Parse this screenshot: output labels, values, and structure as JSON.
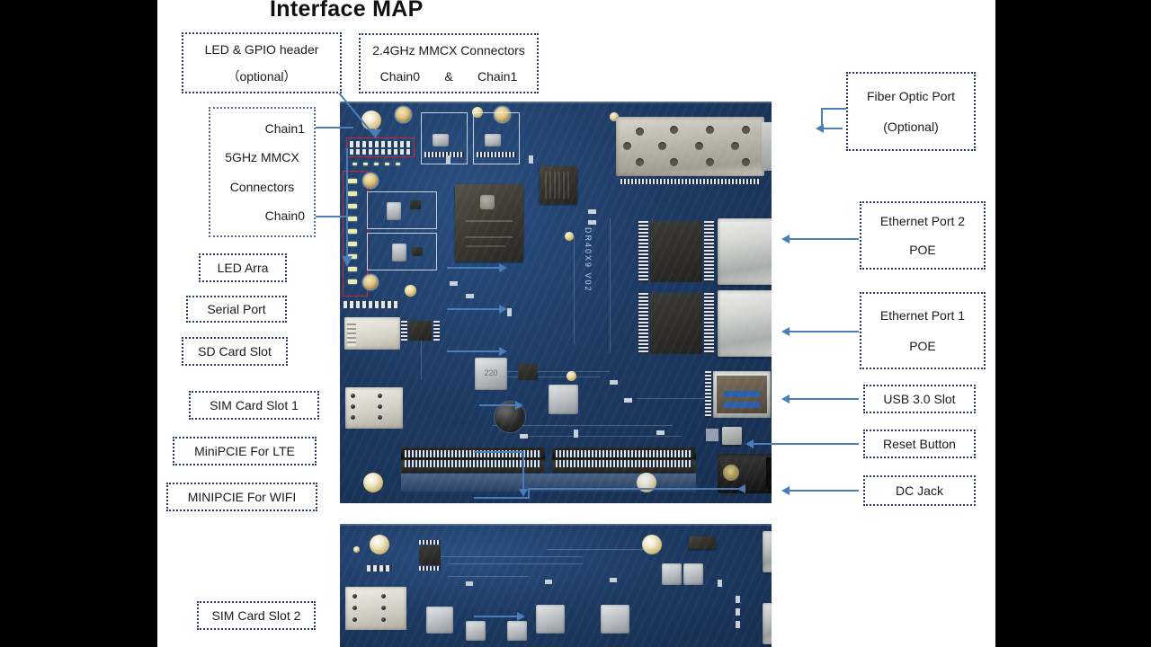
{
  "title": "Interface MAP",
  "board": {
    "silkscreen": "DR40X9 V02",
    "pcb_color": "#1d3a63",
    "accent_color": "#4a7ebb",
    "highlight_color": "#d2232a",
    "inductor_label": "220"
  },
  "labels": {
    "led_gpio": {
      "line1": "LED & GPIO header",
      "line2": "（optional）"
    },
    "mmcx24": {
      "line1": "2.4GHz MMCX Connectors",
      "chain0": "Chain0",
      "amp": "&",
      "chain1": "Chain1"
    },
    "mmcx5": {
      "chain1": "Chain1",
      "line1": "5GHz MMCX",
      "line2": "Connectors",
      "chain0": "Chain0"
    },
    "led_array": {
      "line1": "LED  Arra"
    },
    "serial_port": {
      "line1": "Serial  Port"
    },
    "sd_card": {
      "line1": "SD Card Slot"
    },
    "sim1": {
      "line1": "SIM Card Slot 1"
    },
    "minipcie_lte": {
      "line1": "MiniPCIE  For  LTE"
    },
    "minipcie_wifi": {
      "line1": "MINIPCIE  For  WIFI"
    },
    "sim2": {
      "line1": "SIM Card Slot 2"
    },
    "fiber": {
      "line1": "Fiber Optic Port",
      "line2": "(Optional)"
    },
    "eth2": {
      "line1": "Ethernet Port 2",
      "line2": "POE"
    },
    "eth1": {
      "line1": "Ethernet Port 1",
      "line2": "POE"
    },
    "usb": {
      "line1": "USB 3.0 Slot"
    },
    "reset": {
      "line1": "Reset Button"
    },
    "dcjack": {
      "line1": "DC Jack"
    }
  }
}
